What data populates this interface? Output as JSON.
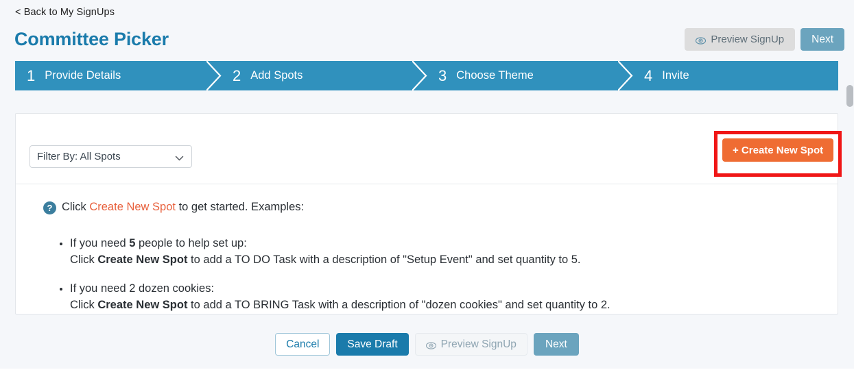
{
  "header": {
    "back_link": "< Back to My SignUps",
    "title": "Committee Picker",
    "preview_label": "Preview SignUp",
    "next_label": "Next"
  },
  "steps": [
    {
      "number": "1",
      "label": "Provide Details"
    },
    {
      "number": "2",
      "label": "Add Spots"
    },
    {
      "number": "3",
      "label": "Choose Theme"
    },
    {
      "number": "4",
      "label": "Invite"
    }
  ],
  "toolbar": {
    "filter_value": "Filter By: All Spots",
    "filter_options": [
      "Filter By: All Spots"
    ],
    "create_label": "+ Create New Spot"
  },
  "instructions": {
    "intro_click": "Click ",
    "intro_link": "Create New Spot",
    "intro_rest": " to get started. Examples:",
    "examples": [
      {
        "line1_pre": "If you need ",
        "line1_bold": "5",
        "line1_post": " people to help set up:",
        "line2_pre": "Click ",
        "line2_bold": "Create New Spot",
        "line2_post": " to add a TO DO Task with a description of \"Setup Event\" and set quantity to 5."
      },
      {
        "line1_pre": "If you need 2 dozen cookies:",
        "line1_bold": "",
        "line1_post": "",
        "line2_pre": "Click ",
        "line2_bold": "Create New Spot",
        "line2_post": " to add a TO BRING Task with a description of \"dozen cookies\" and set quantity to 2."
      }
    ]
  },
  "footer": {
    "cancel_label": "Cancel",
    "save_draft_label": "Save Draft",
    "preview_label": "Preview SignUp",
    "next_label": "Next"
  },
  "colors": {
    "brand_blue": "#1a7bab",
    "step_blue": "#3091bd",
    "accent_orange": "#ef6c33",
    "link_orange": "#e8603c",
    "highlight_red": "#f01616",
    "muted_blue": "#6ba4be",
    "page_bg": "#f5f7fa"
  },
  "icons": {
    "eye": "eye-icon",
    "help": "question-mark-icon",
    "chevron_down": "chevron-down-icon"
  }
}
